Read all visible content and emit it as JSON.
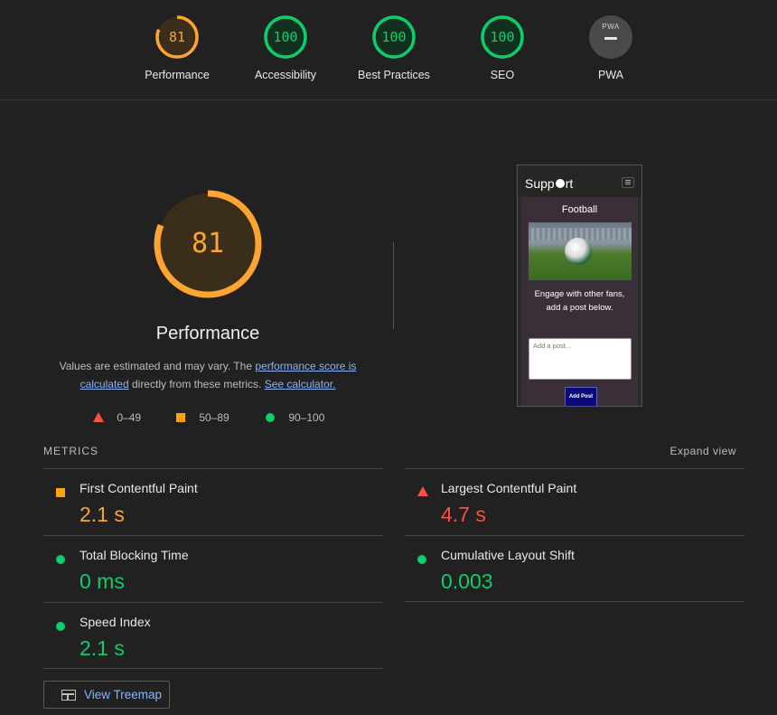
{
  "gauges": [
    {
      "label": "Performance",
      "score": "81",
      "score_value": 81,
      "color": "#ffa331"
    },
    {
      "label": "Accessibility",
      "score": "100",
      "score_value": 100,
      "color": "#0cce6b"
    },
    {
      "label": "Best Practices",
      "score": "100",
      "score_value": 100,
      "color": "#0cce6b"
    },
    {
      "label": "SEO",
      "score": "100",
      "score_value": 100,
      "color": "#0cce6b"
    },
    {
      "label": "PWA",
      "badge_text": "PWA",
      "icon": "pwa-dash-icon"
    }
  ],
  "performance": {
    "score": "81",
    "score_value": 81,
    "title": "Performance",
    "desc_pre": "Values are estimated and may vary. The ",
    "desc_link1": "performance score is calculated",
    "desc_mid": " directly from these metrics. ",
    "desc_link2": "See calculator."
  },
  "legend": [
    {
      "range": "0–49",
      "shape": "triangle",
      "color": "#ff4e42"
    },
    {
      "range": "50–89",
      "shape": "square",
      "color": "#ffa400"
    },
    {
      "range": "90–100",
      "shape": "circle",
      "color": "#0cce6b"
    }
  ],
  "screenshot": {
    "brand": "Supp",
    "brand_end": "rt",
    "title": "Football",
    "body_text": "Engage with other fans, add a post below.",
    "textarea_placeholder": "Add a post...",
    "button_label": "Add Post"
  },
  "metrics": {
    "header": "METRICS",
    "expand_label": "Expand view",
    "items": [
      {
        "label": "First Contentful Paint",
        "value": "2.1 s",
        "status": "average"
      },
      {
        "label": "Largest Contentful Paint",
        "value": "4.7 s",
        "status": "fail"
      },
      {
        "label": "Total Blocking Time",
        "value": "0 ms",
        "status": "pass"
      },
      {
        "label": "Cumulative Layout Shift",
        "value": "0.003",
        "status": "pass"
      },
      {
        "label": "Speed Index",
        "value": "2.1 s",
        "status": "pass"
      }
    ]
  },
  "treemap_button": "View Treemap"
}
